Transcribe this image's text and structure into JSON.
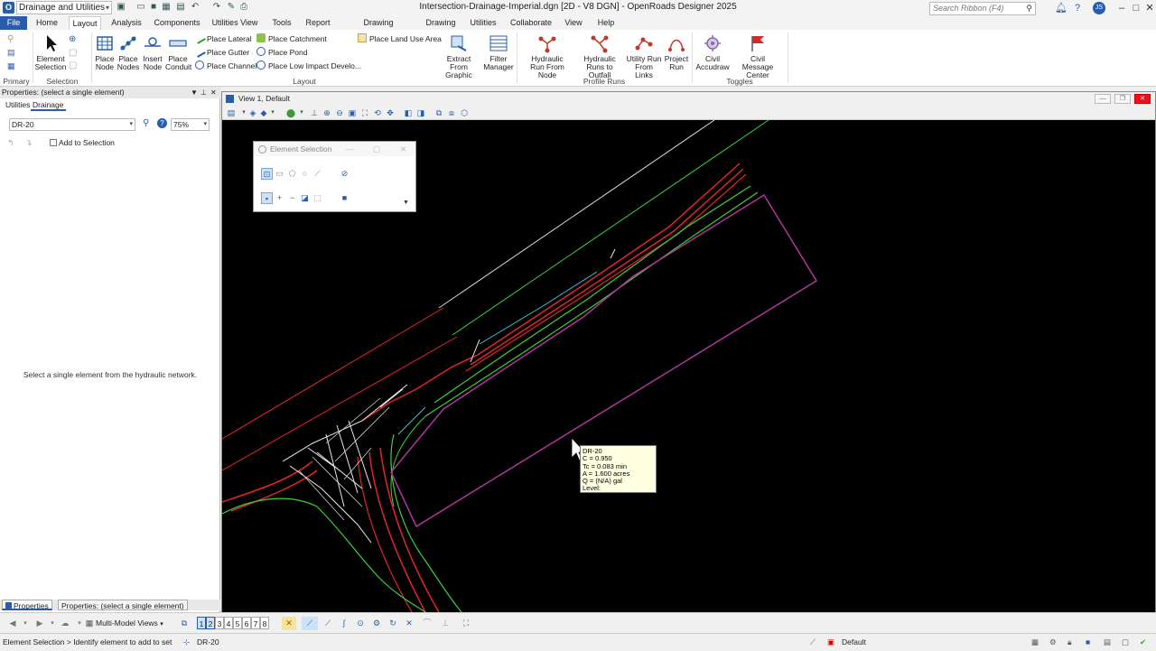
{
  "app": {
    "workflow": "Drainage and Utilities",
    "window_title": "Intersection-Drainage-Imperial.dgn [2D - V8 DGN] - OpenRoads Designer 2025",
    "search_placeholder": "Search Ribbon (F4)"
  },
  "menu": {
    "tabs": [
      "File",
      "Home",
      "Layout",
      "Analysis",
      "Components",
      "Utilities View",
      "Tools",
      "Report",
      "Drawing Production",
      "Drawing",
      "Utilities",
      "Collaborate",
      "View",
      "Help"
    ],
    "active": "Layout"
  },
  "ribbon": {
    "groups": {
      "primary": "Primary",
      "selection": "Selection",
      "layout": "Layout",
      "profile_runs": "Profile Runs",
      "toggles": "Toggles"
    },
    "element_selection": {
      "l1": "Element",
      "l2": "Selection"
    },
    "place_node": {
      "l1": "Place",
      "l2": "Node"
    },
    "place_nodes": {
      "l1": "Place",
      "l2": "Nodes"
    },
    "insert_node": {
      "l1": "Insert",
      "l2": "Node"
    },
    "place_conduit": {
      "l1": "Place",
      "l2": "Conduit"
    },
    "small_col1": [
      "Place Lateral",
      "Place Gutter",
      "Place Channel"
    ],
    "small_col2": [
      "Place Catchment",
      "Place Pond",
      "Place Low Impact Develo..."
    ],
    "place_land_use": "Place Land Use Area",
    "extract": {
      "l1": "Extract",
      "l2": "From Graphic"
    },
    "filter": {
      "l1": "Filter",
      "l2": "Manager"
    },
    "hyd_run_node": {
      "l1": "Hydraulic",
      "l2": "Run From Node"
    },
    "hyd_runs_outfall": {
      "l1": "Hydraulic",
      "l2": "Runs to Outfall"
    },
    "utility_run": {
      "l1": "Utility Run",
      "l2": "From Links"
    },
    "project_run": {
      "l1": "Project",
      "l2": "Run"
    },
    "civil_accudraw": {
      "l1": "Civil",
      "l2": "Accudraw"
    },
    "civil_msg": {
      "l1": "Civil",
      "l2": "Message Center"
    }
  },
  "left_panel": {
    "header": "Properties: (select a single element)",
    "tabs": [
      "Utilities",
      "Drainage"
    ],
    "element_select": "DR-20",
    "zoom": "75%",
    "add_to_selection": "Add to Selection",
    "message": "Select a single element from the hydraulic network.",
    "bottom_tabs": [
      "Properties",
      "Properties: (select a single element)"
    ]
  },
  "view": {
    "title": "View 1, Default"
  },
  "element_selection_dialog": {
    "title": "Element Selection"
  },
  "tooltip": {
    "lines": [
      "DR-20",
      "C = 0.950",
      "Tc = 0.083 min",
      "A = 1.600 acres",
      "Q = (N/A) gal",
      "Level: Util_Storm_Areas"
    ]
  },
  "viewbar": {
    "multi_model": "Multi-Model Views",
    "view_numbers": [
      "1",
      "2",
      "3",
      "4",
      "5",
      "6",
      "7",
      "8"
    ]
  },
  "status": {
    "prompt": "Element Selection > Identify element to add to set",
    "selected": "DR-20",
    "level": "Default"
  },
  "colors": {
    "accent": "#2a5da8",
    "red_line": "#e0262b",
    "green_line": "#3ad13a",
    "purple_line": "#b0359c",
    "cyan_line": "#37c6e0",
    "gray_line": "#cfcfcf"
  }
}
